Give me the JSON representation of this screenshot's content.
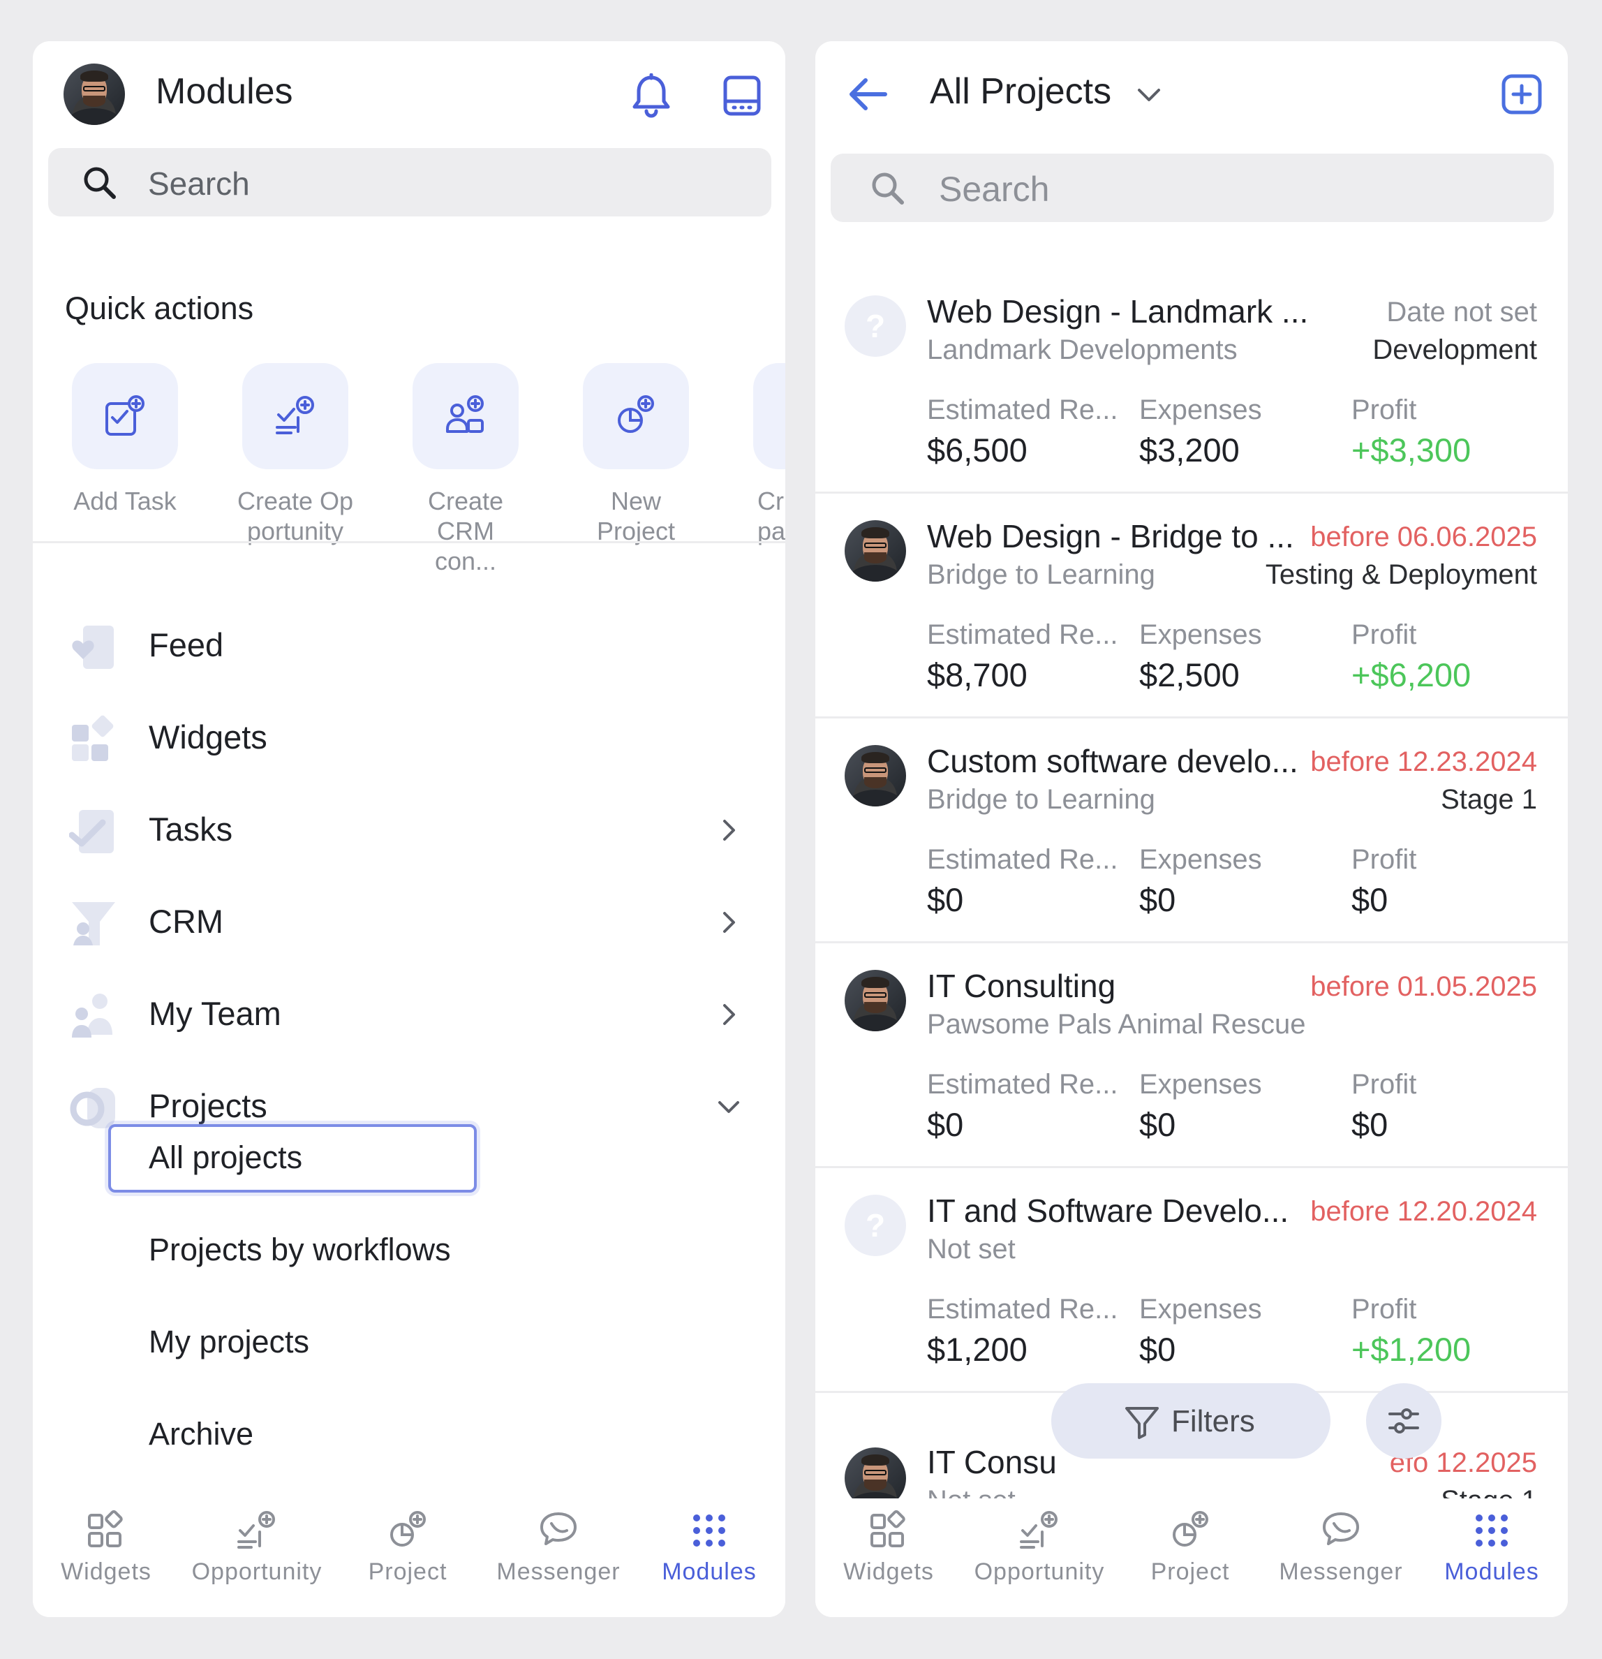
{
  "left": {
    "header": {
      "title": "Modules"
    },
    "search": {
      "placeholder": "Search"
    },
    "quick_actions": {
      "title": "Quick actions",
      "items": [
        {
          "label": "Add Task",
          "icon": "add-task-icon"
        },
        {
          "label": "Create Op portunity",
          "icon": "create-opportunity-icon"
        },
        {
          "label": "Create CRM con...",
          "icon": "create-crm-contact-icon"
        },
        {
          "label": "New Project",
          "icon": "new-project-icon"
        },
        {
          "label": "Cr pa",
          "icon": "create-page-icon"
        }
      ]
    },
    "menu": [
      {
        "label": "Feed",
        "icon": "feed-icon",
        "chevron": "none"
      },
      {
        "label": "Widgets",
        "icon": "widgets-icon",
        "chevron": "none"
      },
      {
        "label": "Tasks",
        "icon": "tasks-icon",
        "chevron": "right"
      },
      {
        "label": "CRM",
        "icon": "crm-icon",
        "chevron": "right"
      },
      {
        "label": "My Team",
        "icon": "team-icon",
        "chevron": "right"
      },
      {
        "label": "Projects",
        "icon": "projects-icon",
        "chevron": "down"
      }
    ],
    "submenu": [
      "All projects",
      "Projects by workflows",
      "My projects",
      "Archive"
    ],
    "selected_submenu": "All projects"
  },
  "right": {
    "header": {
      "title": "All Projects"
    },
    "search": {
      "placeholder": "Search"
    },
    "metric_labels": {
      "revenue": "Estimated Re...",
      "expenses": "Expenses",
      "profit": "Profit"
    },
    "projects": [
      {
        "name": "Web Design - Landmark ...",
        "date": "Date not set",
        "overdue": false,
        "client": "Landmark Developments",
        "stage": "Development",
        "revenue": "$6,500",
        "expenses": "$3,200",
        "profit": "+$3,300",
        "profit_positive": true,
        "has_avatar": false
      },
      {
        "name": "Web Design - Bridge to ...",
        "date": "before 06.06.2025",
        "overdue": true,
        "client": "Bridge to Learning",
        "stage": "Testing & Deployment",
        "revenue": "$8,700",
        "expenses": "$2,500",
        "profit": "+$6,200",
        "profit_positive": true,
        "has_avatar": true
      },
      {
        "name": "Custom software develo...",
        "date": "before 12.23.2024",
        "overdue": true,
        "client": "Bridge to Learning",
        "stage": "Stage 1",
        "revenue": "$0",
        "expenses": "$0",
        "profit": "$0",
        "profit_positive": false,
        "has_avatar": true
      },
      {
        "name": "IT Consulting",
        "date": "before 01.05.2025",
        "overdue": true,
        "client": "Pawsome Pals Animal Rescue",
        "stage": "",
        "revenue": "$0",
        "expenses": "$0",
        "profit": "$0",
        "profit_positive": false,
        "has_avatar": true
      },
      {
        "name": "IT and Software Develo...",
        "date": "before 12.20.2024",
        "overdue": true,
        "client": "Not set",
        "stage": "",
        "revenue": "$1,200",
        "expenses": "$0",
        "profit": "+$1,200",
        "profit_positive": true,
        "has_avatar": false
      },
      {
        "name": "IT Consu",
        "date": "efo 12.2025",
        "overdue": true,
        "client": "Not set",
        "stage": "Stage 1",
        "has_avatar": true
      }
    ],
    "filters_label": "Filters"
  },
  "bottom_nav": [
    {
      "label": "Widgets",
      "icon": "widgets-icon"
    },
    {
      "label": "Opportunity",
      "icon": "opportunity-icon"
    },
    {
      "label": "Project",
      "icon": "project-icon"
    },
    {
      "label": "Messenger",
      "icon": "messenger-icon"
    },
    {
      "label": "Modules",
      "icon": "modules-grid-icon",
      "active": true
    }
  ],
  "colors": {
    "accent": "#4a5fd9",
    "overdue": "#e26161",
    "positive": "#4cc65a",
    "muted": "#8d9097"
  }
}
